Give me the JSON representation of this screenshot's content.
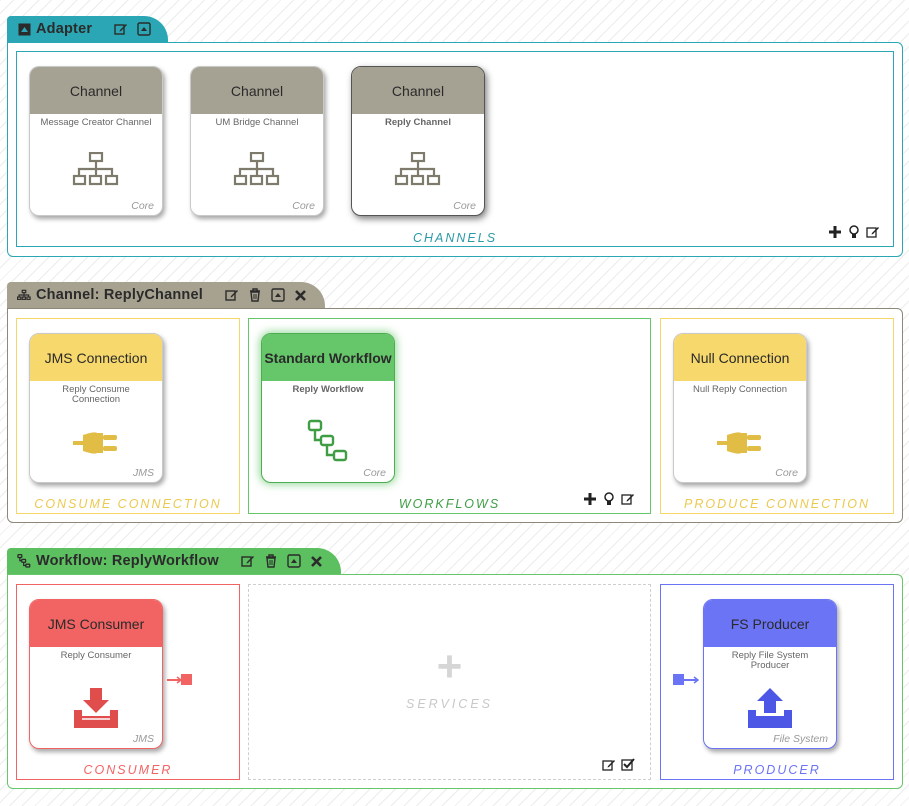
{
  "adapter": {
    "title": "Adapter",
    "accent": "#2aa6b4",
    "panel_label": "CHANNELS",
    "cards": [
      {
        "head": "Channel",
        "sub": "Message Creator Channel",
        "foot": "Core",
        "icon": "sitemap-icon"
      },
      {
        "head": "Channel",
        "sub": "UM Bridge Channel",
        "foot": "Core",
        "icon": "sitemap-icon"
      },
      {
        "head": "Channel",
        "sub": "Reply Channel",
        "foot": "Core",
        "icon": "sitemap-icon",
        "selected": true
      }
    ]
  },
  "channel": {
    "title": "Channel: ReplyChannel",
    "accent": "#a7a190",
    "consume": {
      "label": "CONSUME CONNECTION",
      "card": {
        "head": "JMS Connection",
        "sub": "Reply Consume Connection",
        "foot": "JMS",
        "icon": "plug-icon"
      }
    },
    "workflows": {
      "label": "WORKFLOWS",
      "card": {
        "head": "Standard Workflow",
        "sub": "Reply Workflow",
        "foot": "Core",
        "icon": "workflow-icon"
      }
    },
    "produce": {
      "label": "PRODUCE CONNECTION",
      "card": {
        "head": "Null Connection",
        "sub": "Null Reply Connection",
        "foot": "Core",
        "icon": "plug-icon"
      }
    }
  },
  "workflow": {
    "title": "Workflow: ReplyWorkflow",
    "accent": "#5cbf60",
    "consumer": {
      "label": "CONSUMER",
      "card": {
        "head": "JMS Consumer",
        "sub": "Reply Consumer",
        "foot": "JMS",
        "icon": "download-tray-icon"
      }
    },
    "services": {
      "label": "SERVICES",
      "plus": "+"
    },
    "producer": {
      "label": "PRODUCER",
      "card": {
        "head": "FS Producer",
        "sub": "Reply File System Producer",
        "foot": "File System",
        "icon": "upload-tray-icon"
      }
    }
  },
  "colors": {
    "teal": "#2aa6b4",
    "grey_head": "#a6a293",
    "yellow": "#f5d66b",
    "yellow_text": "#e8c84f",
    "green": "#66c66a",
    "green_text": "#3f9e44",
    "red": "#f26464",
    "blue": "#6b74f5"
  }
}
